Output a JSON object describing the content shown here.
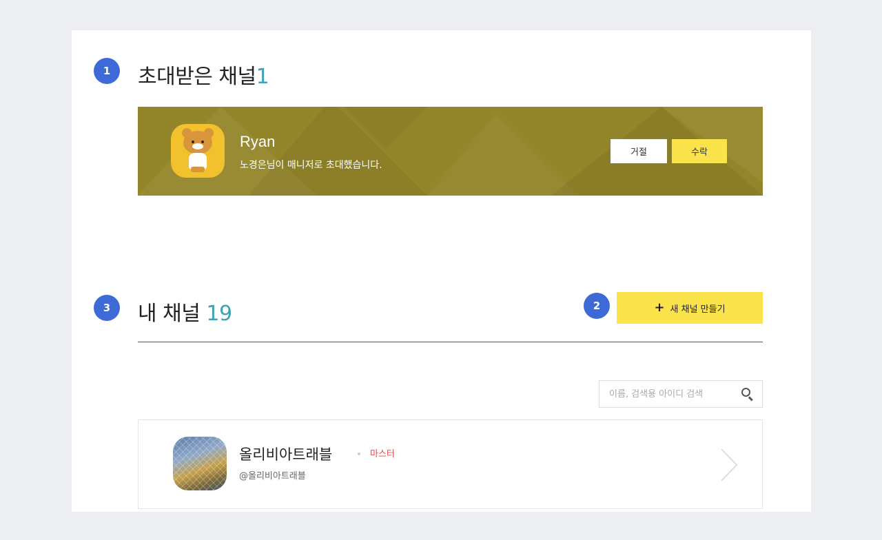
{
  "steps": {
    "invited": "1",
    "create": "2",
    "my_channels": "3"
  },
  "invited_section": {
    "title": "초대받은 채널",
    "count": "1",
    "invite": {
      "name": "Ryan",
      "message": "노경은님이 매니저로 초대했습니다.",
      "decline_label": "거절",
      "accept_label": "수락"
    }
  },
  "my_channels_section": {
    "title": "내 채널",
    "count": "19",
    "create_label": "새 채널 만들기",
    "search_placeholder": "이름, 검색용 아이디 검색",
    "channels": [
      {
        "name": "올리비아트래블",
        "role": "마스터",
        "handle": "@올리비아트래블"
      }
    ]
  },
  "colors": {
    "accent": "#3d6ad6",
    "count": "#3aa3b4",
    "banner": "#93852a",
    "yellow": "#fbe34b",
    "role": "#e64a4a"
  },
  "icons": {
    "search": "search-icon",
    "chevron": "chevron-right-icon",
    "plus": "plus-icon"
  }
}
